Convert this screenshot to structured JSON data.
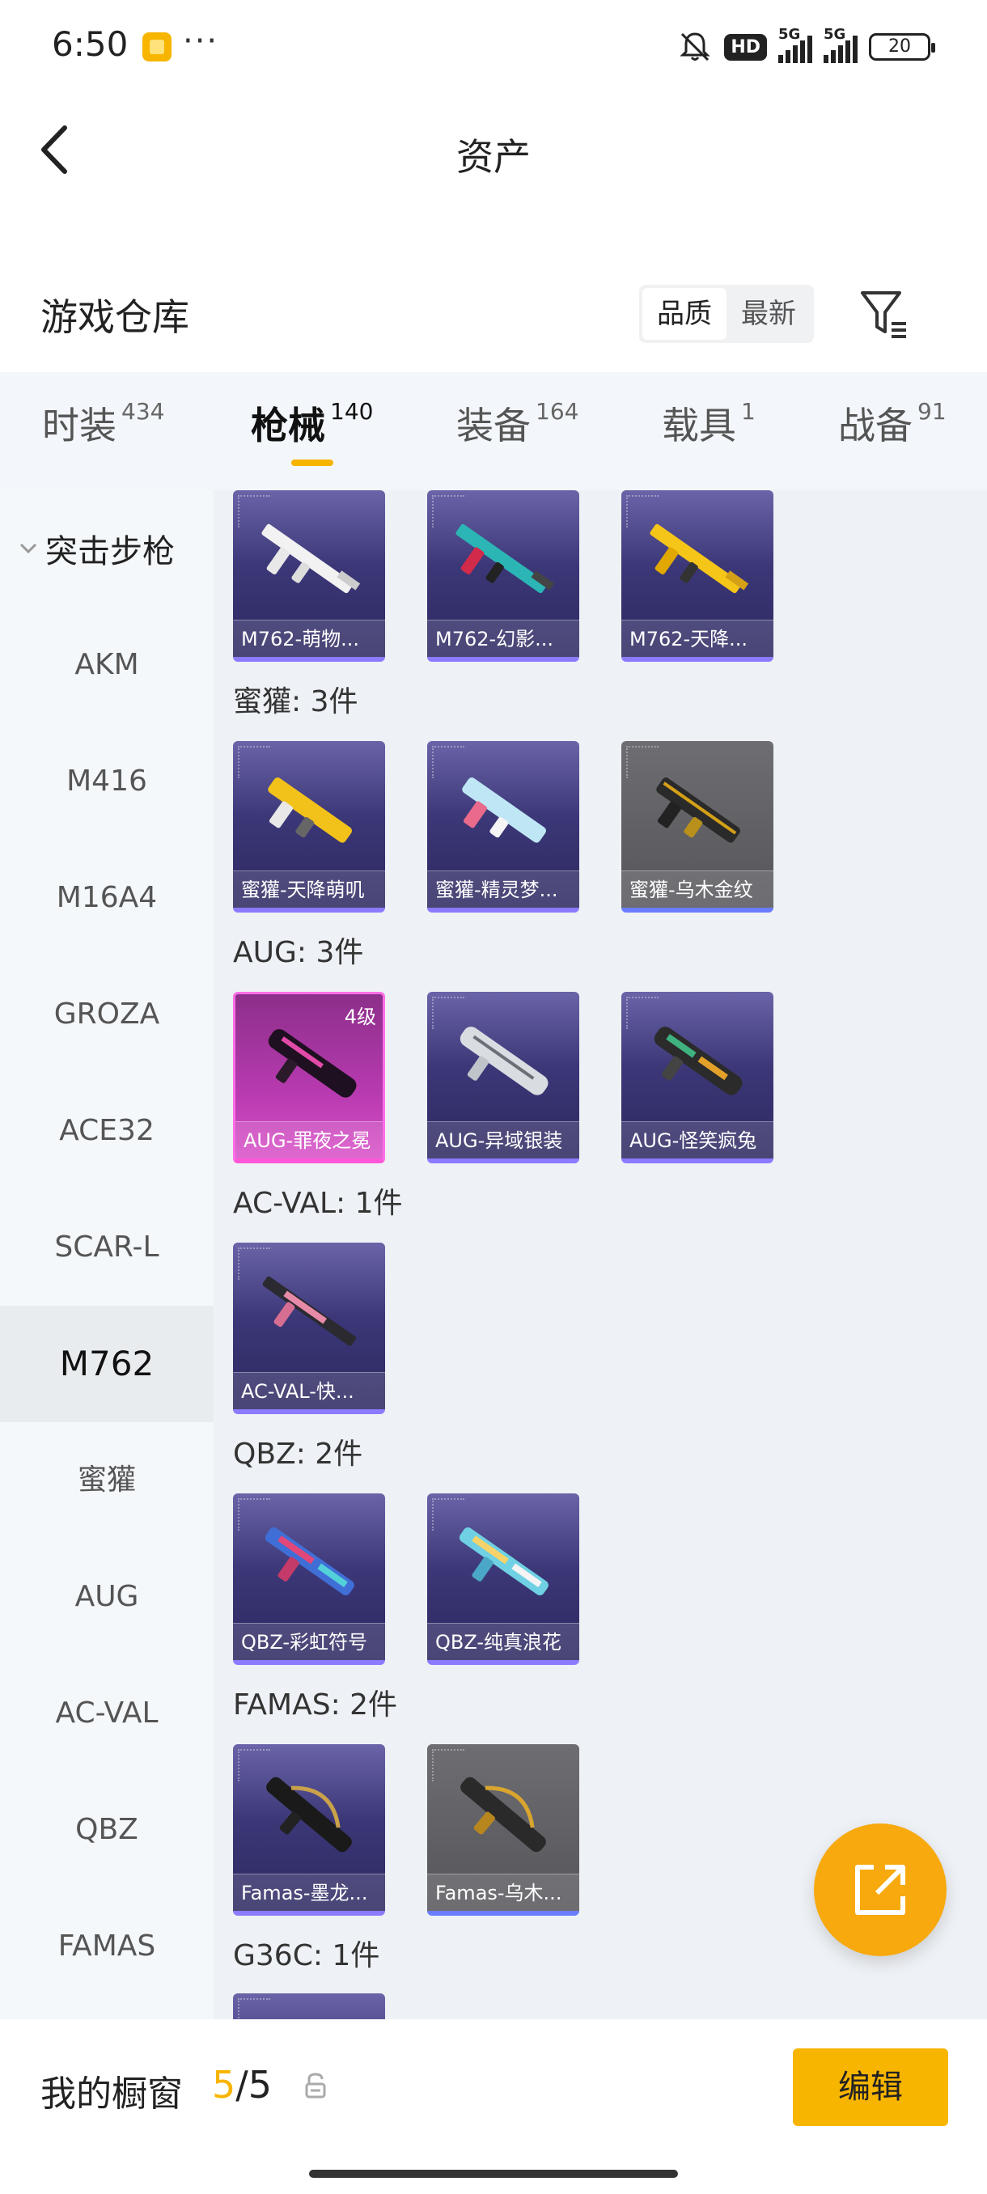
{
  "status_bar": {
    "time": "6:50",
    "hd_label": "HD",
    "network_1": "5G",
    "network_2": "5G",
    "battery": "20"
  },
  "nav": {
    "title": "资产"
  },
  "section": {
    "title": "游戏仓库",
    "sort_options": [
      "品质",
      "最新"
    ]
  },
  "tabs": [
    {
      "label": "时装",
      "count": "434"
    },
    {
      "label": "枪械",
      "count": "140"
    },
    {
      "label": "装备",
      "count": "164"
    },
    {
      "label": "载具",
      "count": "1"
    },
    {
      "label": "战备",
      "count": "91"
    }
  ],
  "sidebar": {
    "group": "突击步枪",
    "items": [
      "AKM",
      "M416",
      "M16A4",
      "GROZA",
      "ACE32",
      "SCAR-L",
      "M762",
      "蜜獾",
      "AUG",
      "AC-VAL",
      "QBZ",
      "FAMAS"
    ],
    "active": "M762"
  },
  "content": {
    "row0": [
      "M762-萌物...",
      "M762-幻影...",
      "M762-天降..."
    ],
    "groups": [
      {
        "label": "蜜獾: 3件",
        "items": [
          "蜜獾-天降萌叽",
          "蜜獾-精灵梦...",
          "蜜獾-乌木金纹"
        ]
      },
      {
        "label": "AUG: 3件",
        "items": [
          "AUG-罪夜之冕",
          "AUG-异域银装",
          "AUG-怪笑疯兔"
        ],
        "level": "4级"
      },
      {
        "label": "AC-VAL: 1件",
        "items": [
          "AC-VAL-快..."
        ]
      },
      {
        "label": "QBZ: 2件",
        "items": [
          "QBZ-彩虹符号",
          "QBZ-纯真浪花"
        ]
      },
      {
        "label": "FAMAS: 2件",
        "items": [
          "Famas-墨龙...",
          "Famas-乌木..."
        ]
      },
      {
        "label": "G36C: 1件",
        "items": []
      }
    ]
  },
  "bottom": {
    "title": "我的橱窗",
    "count_current": "5",
    "count_sep": "/",
    "count_total": "5",
    "edit_label": "编辑"
  },
  "colors": {
    "accent": "#f7b500",
    "fab": "#f7a90e",
    "card_purple": "#3c3878",
    "card_gray": "#55555a",
    "card_pink": "#b83ab0"
  }
}
